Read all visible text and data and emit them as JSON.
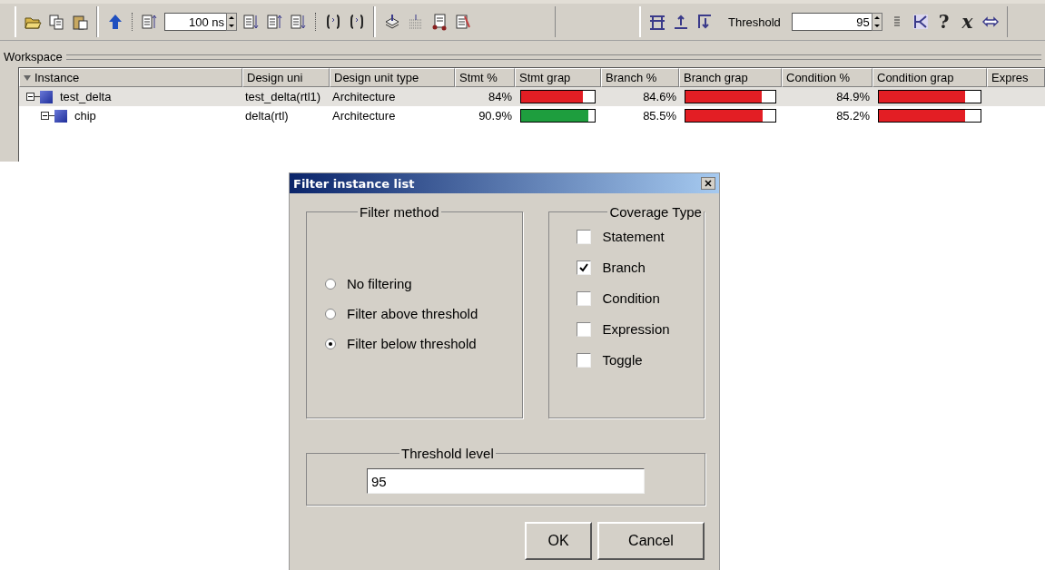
{
  "toolbar": {
    "time_field": {
      "value": "100 ns"
    },
    "threshold_label": "Threshold",
    "threshold_field": {
      "value": "95"
    },
    "glyph_buttons": [
      "?",
      "x"
    ]
  },
  "workspace": {
    "title": "Workspace"
  },
  "table": {
    "columns": [
      "Instance",
      "Design uni",
      "Design unit type",
      "Stmt %",
      "Stmt grap",
      "Branch %",
      "Branch grap",
      "Condition %",
      "Condition grap",
      "Expres"
    ],
    "rows": [
      {
        "instance": "test_delta",
        "design_unit": "test_delta(rtl1)",
        "design_unit_type": "Architecture",
        "stmt_pct": "84%",
        "stmt_graph": {
          "level": 0.84,
          "color": "#e31e24"
        },
        "branch_pct": "84.6%",
        "branch_graph": {
          "level": 0.846,
          "color": "#e31e24"
        },
        "condition_pct": "84.9%",
        "condition_graph": {
          "level": 0.849,
          "color": "#e31e24"
        },
        "expanded": true,
        "selected": true,
        "children": [
          {
            "instance": "chip",
            "design_unit": "delta(rtl)",
            "design_unit_type": "Architecture",
            "stmt_pct": "90.9%",
            "stmt_graph": {
              "level": 0.909,
              "color": "#1e9e3e"
            },
            "branch_pct": "85.5%",
            "branch_graph": {
              "level": 0.855,
              "color": "#e31e24"
            },
            "condition_pct": "85.2%",
            "condition_graph": {
              "level": 0.852,
              "color": "#e31e24"
            },
            "expanded": true,
            "selected": false
          }
        ]
      }
    ]
  },
  "dialog": {
    "title": "Filter instance list",
    "filter_method": {
      "title": "Filter method",
      "options": [
        {
          "label": "No filtering",
          "selected": false
        },
        {
          "label": "Filter above threshold",
          "selected": false
        },
        {
          "label": "Filter below threshold",
          "selected": true
        }
      ]
    },
    "coverage_type": {
      "title": "Coverage Type",
      "options": [
        {
          "label": "Statement",
          "checked": false
        },
        {
          "label": "Branch",
          "checked": true
        },
        {
          "label": "Condition",
          "checked": false
        },
        {
          "label": "Expression",
          "checked": false
        },
        {
          "label": "Toggle",
          "checked": false
        }
      ]
    },
    "threshold": {
      "title": "Threshold level",
      "value": "95"
    },
    "buttons": [
      "OK",
      "Cancel"
    ]
  }
}
